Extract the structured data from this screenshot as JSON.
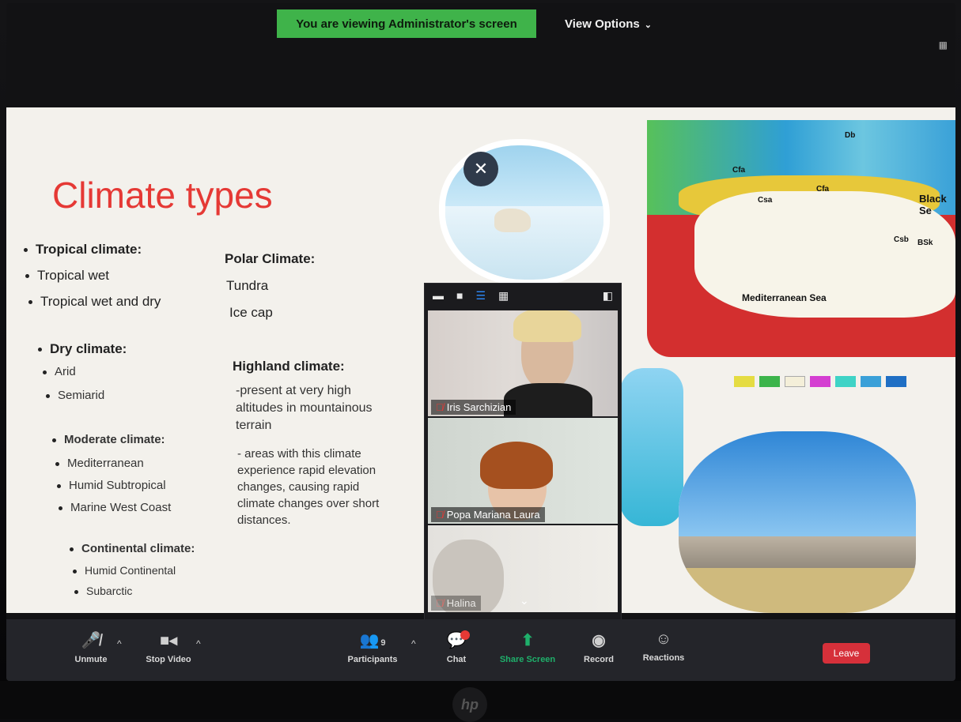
{
  "banner": {
    "viewing": "You are viewing Administrator's screen",
    "view_options": "View Options"
  },
  "slide": {
    "title": "Climate types",
    "col1": {
      "tropical": {
        "heading": "Tropical climate:",
        "items": [
          "Tropical wet",
          "Tropical wet and dry"
        ]
      },
      "dry": {
        "heading": "Dry climate:",
        "items": [
          "Arid",
          "Semiarid"
        ]
      },
      "moderate": {
        "heading": "Moderate climate:",
        "items": [
          "Mediterranean",
          "Humid Subtropical",
          "Marine West Coast"
        ]
      },
      "continental": {
        "heading": "Continental climate:",
        "items": [
          "Humid Continental",
          "Subarctic"
        ]
      }
    },
    "col2": {
      "polar": {
        "heading": "Polar Climate:",
        "items": [
          "Tundra",
          "Ice cap"
        ]
      },
      "highland": {
        "heading": "Highland climate:",
        "para1": [
          "-present at very high",
          "altitudes in mountainous",
          "terrain"
        ],
        "para2": [
          "- areas with this climate",
          "experience rapid elevation",
          "changes, causing rapid",
          "climate changes over short",
          "distances."
        ]
      }
    },
    "map": {
      "sea_label": "Mediterranean Sea",
      "black_sea_label": "Black Se",
      "zone_labels": [
        "Cfa",
        "Csa",
        "Cfa",
        "Csb",
        "BSk",
        "Db"
      ]
    },
    "legend_colors": [
      "#e5dc42",
      "#3cb44b",
      "#f4efd9",
      "#d43fd1",
      "#3fd3c6",
      "#3aa0d8",
      "#1f6fc4"
    ]
  },
  "video_panel": {
    "participants": [
      {
        "name": "Iris Sarchizian",
        "muted": true
      },
      {
        "name": "Popa Mariana Laura",
        "muted": true
      },
      {
        "name": "Halina",
        "muted": true
      }
    ]
  },
  "toolbar": {
    "unmute": "Unmute",
    "stop_video": "Stop Video",
    "participants": "Participants",
    "participants_count": "9",
    "chat": "Chat",
    "share_screen": "Share Screen",
    "record": "Record",
    "reactions": "Reactions",
    "leave": "Leave"
  },
  "colors": {
    "title_red": "#e53935",
    "banner_green": "#3fb34a",
    "share_green": "#1fb06b",
    "leave_red": "#d6303a"
  }
}
